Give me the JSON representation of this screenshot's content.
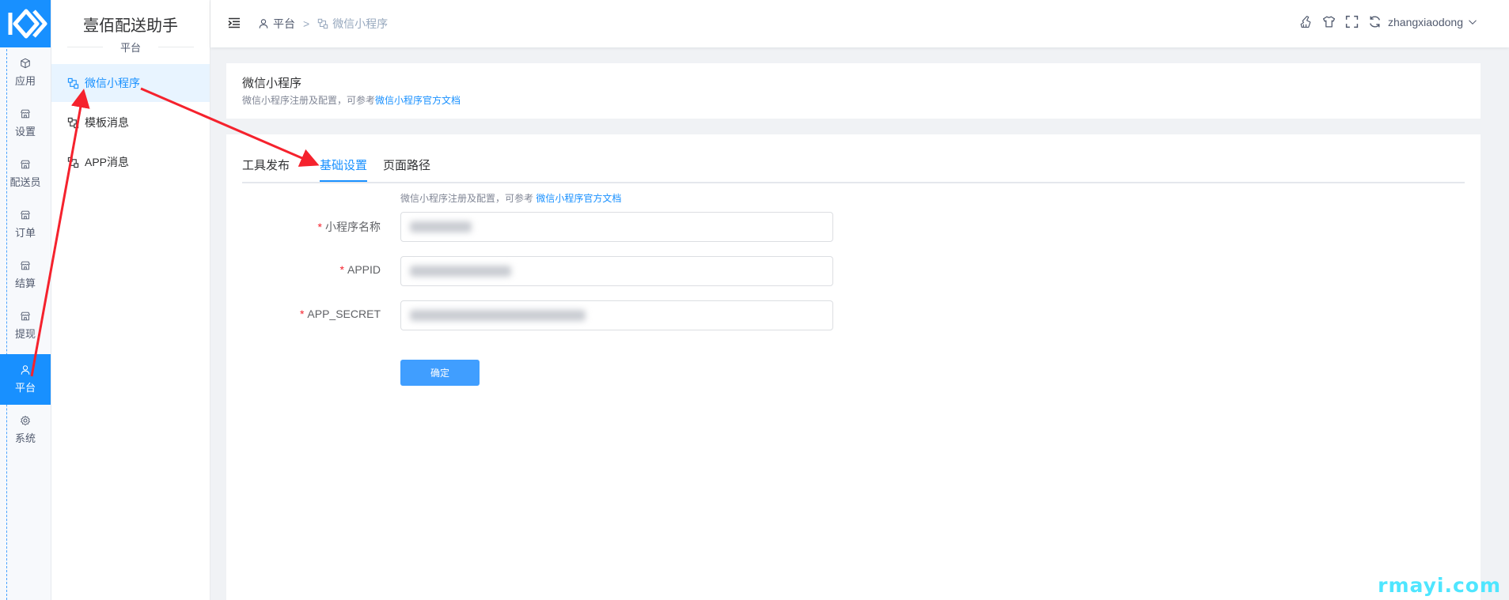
{
  "app": {
    "name": "壹佰配送助手",
    "section": "平台"
  },
  "rail": {
    "items": [
      {
        "label": "应用",
        "icon": "cube-icon"
      },
      {
        "label": "设置",
        "icon": "store-icon"
      },
      {
        "label": "配送员",
        "icon": "store-icon"
      },
      {
        "label": "订单",
        "icon": "store-icon"
      },
      {
        "label": "结算",
        "icon": "store-icon"
      },
      {
        "label": "提现",
        "icon": "store-icon"
      },
      {
        "label": "平台",
        "icon": "user-icon",
        "active": true
      },
      {
        "label": "系统",
        "icon": "gear-icon"
      }
    ]
  },
  "submenu": {
    "items": [
      {
        "label": "微信小程序",
        "active": true
      },
      {
        "label": "模板消息"
      },
      {
        "label": "APP消息"
      }
    ]
  },
  "header": {
    "breadcrumb": [
      "平台",
      "微信小程序"
    ],
    "breadcrumb_sep": ">",
    "user": "zhangxiaodong"
  },
  "info": {
    "title": "微信小程序",
    "desc_prefix": "微信小程序注册及配置，可参考",
    "doc_link": "微信小程序官方文档"
  },
  "tabs": [
    {
      "label": "工具发布"
    },
    {
      "label": "基础设置",
      "active": true
    },
    {
      "label": "页面路径"
    }
  ],
  "form": {
    "tip_prefix": "微信小程序注册及配置，可参考",
    "tip_link": "微信小程序官方文档",
    "fields": [
      {
        "label": "小程序名称",
        "required": true,
        "value": ""
      },
      {
        "label": "APPID",
        "required": true,
        "value": ""
      },
      {
        "label": "APP_SECRET",
        "required": true,
        "value": ""
      }
    ],
    "submit": "确定"
  },
  "watermark": "rmayi.com",
  "colors": {
    "primary": "#1890ff",
    "button": "#409eff",
    "annotation": "#f5222d"
  }
}
